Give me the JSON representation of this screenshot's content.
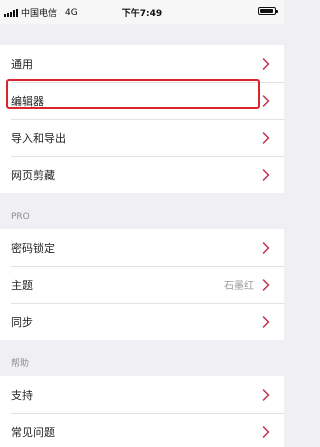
{
  "status_bar": {
    "carrier": "中国电信",
    "network": "4G",
    "time": "下午7:49"
  },
  "general_group": {
    "items": [
      {
        "label": "通用"
      },
      {
        "label": "编辑器"
      },
      {
        "label": "导入和导出"
      },
      {
        "label": "网页剪藏"
      }
    ]
  },
  "pro_group": {
    "header": "PRO",
    "items": [
      {
        "label": "密码锁定"
      },
      {
        "label": "主题",
        "value": "石墨红"
      },
      {
        "label": "同步"
      }
    ]
  },
  "help_group": {
    "header": "帮助",
    "items": [
      {
        "label": "支持"
      },
      {
        "label": "常见问题"
      }
    ]
  },
  "colors": {
    "accent": "#c0334d",
    "highlight_border": "#d9262a",
    "background": "#efeff4"
  }
}
